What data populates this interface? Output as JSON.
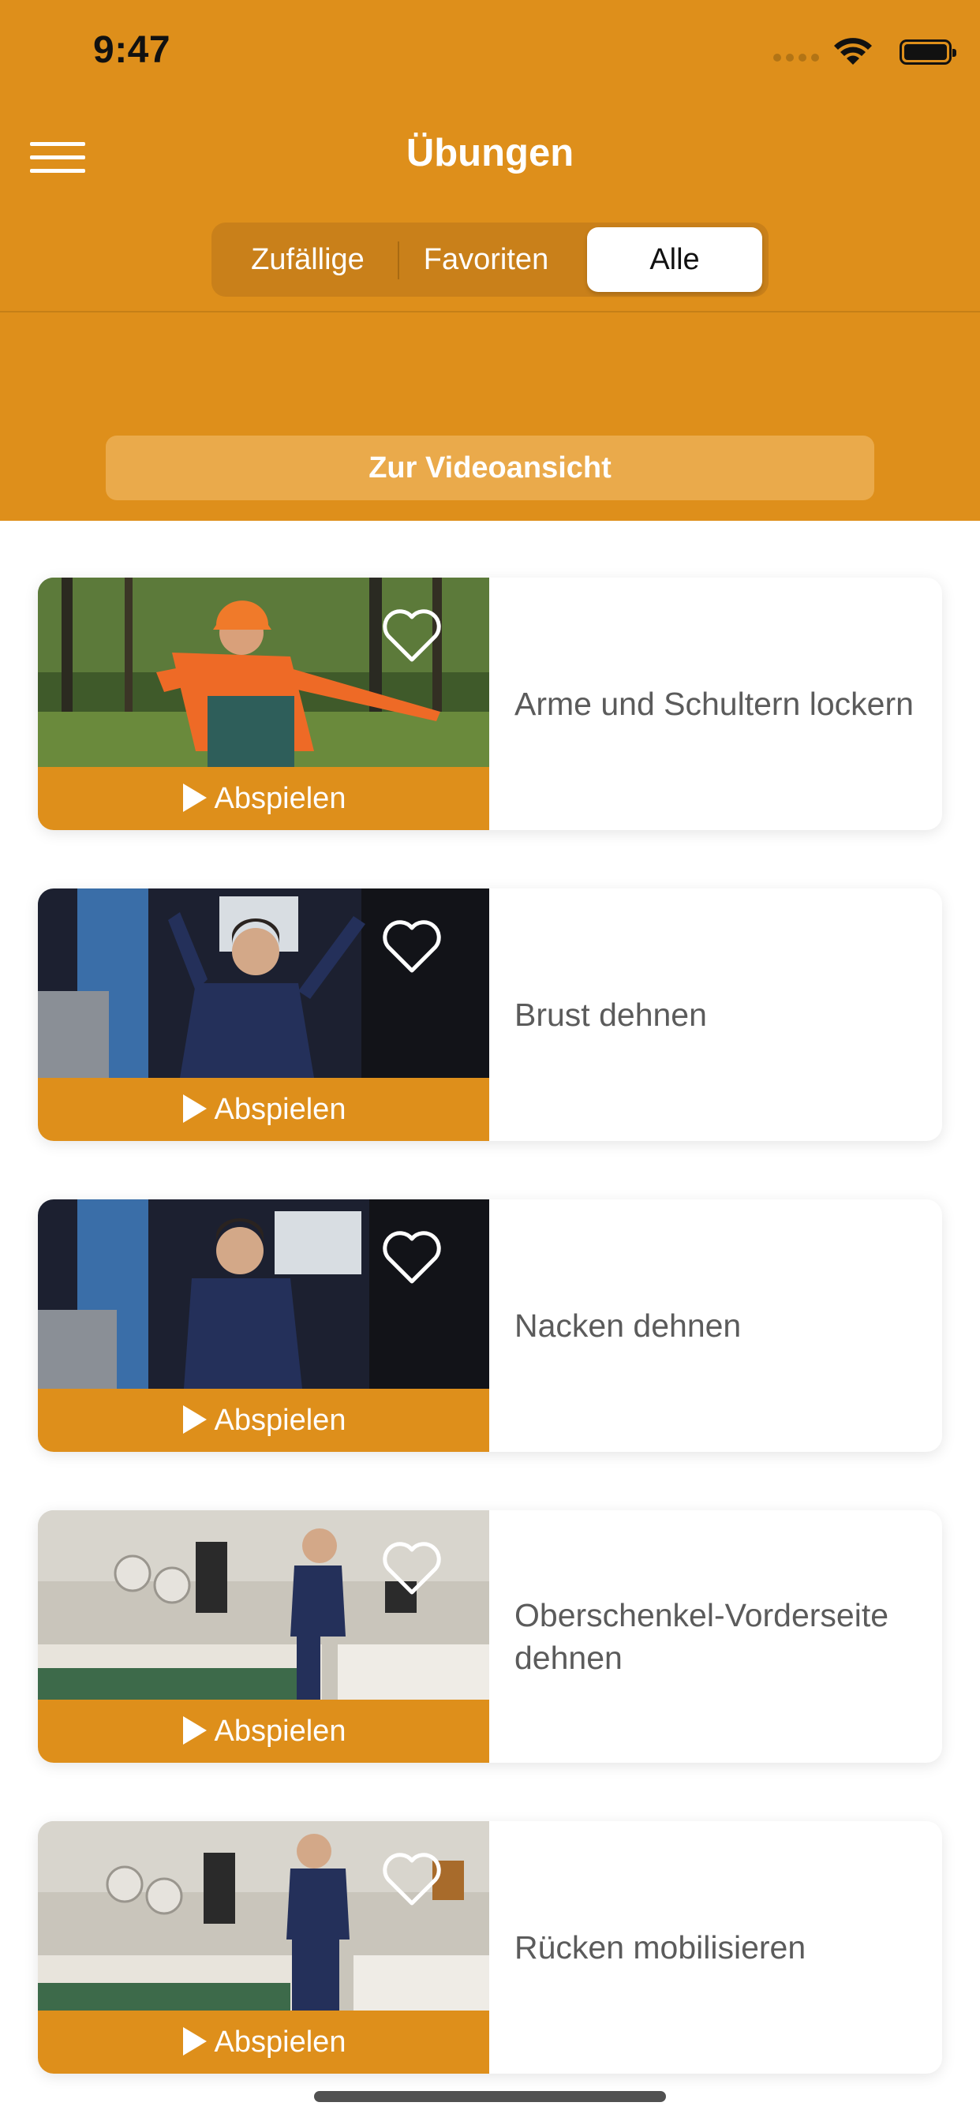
{
  "status_bar": {
    "time": "9:47"
  },
  "header": {
    "title": "Übungen",
    "menu_icon": "hamburger-menu-icon",
    "segments": [
      {
        "label": "Zufällige",
        "active": false
      },
      {
        "label": "Favoriten",
        "active": false
      },
      {
        "label": "Alle",
        "active": true
      }
    ],
    "video_view_button": "Zur Videoansicht"
  },
  "exercises": [
    {
      "title": "Arme und Schultern lockern",
      "play_label": "Abspielen",
      "favorite": false,
      "scene": "forest worker in orange safety jacket and helmet"
    },
    {
      "title": "Brust dehnen",
      "play_label": "Abspielen",
      "favorite": false,
      "scene": "worker in blue overall, arms raised"
    },
    {
      "title": "Nacken dehnen",
      "play_label": "Abspielen",
      "favorite": false,
      "scene": "worker in blue overall, head tilted"
    },
    {
      "title": "Oberschenkel-Vorderseite dehnen",
      "play_label": "Abspielen",
      "favorite": false,
      "scene": "worker in workshop stretching leg"
    },
    {
      "title": "Rücken mobilisieren",
      "play_label": "Abspielen",
      "favorite": false,
      "scene": "worker in workshop, hands on hips"
    }
  ],
  "colors": {
    "brand": "#DE8F1B",
    "segment_bg": "#C9801A",
    "button_bg": "#EAAA4B",
    "text_gray": "#5b5b5b"
  }
}
